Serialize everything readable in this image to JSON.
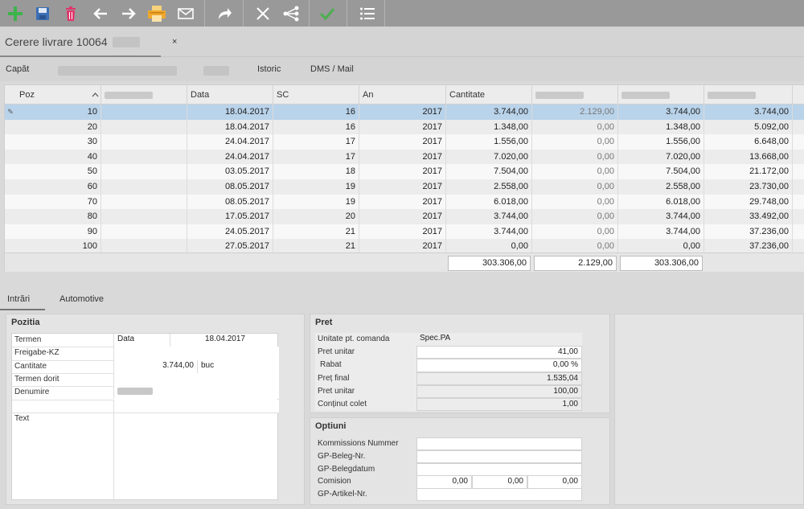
{
  "toolbar": {
    "buttons": [
      {
        "name": "add-icon",
        "color": "#3cb44b"
      },
      {
        "name": "save-icon",
        "color": "#3c6fb4"
      },
      {
        "name": "delete-icon",
        "color": "#e0356b"
      },
      {
        "name": "arrow-left-icon",
        "color": "#ffffff"
      },
      {
        "name": "arrow-right-icon",
        "color": "#ffffff"
      },
      {
        "name": "print-icon",
        "color": "#f0a830"
      },
      {
        "name": "mail-icon",
        "color": "#ffffff"
      },
      {
        "name": "forward-icon",
        "color": "#ffffff"
      },
      {
        "name": "close-x-icon",
        "color": "#ffffff"
      },
      {
        "name": "share-tree-icon",
        "color": "#ffffff"
      },
      {
        "name": "check-icon",
        "color": "#4caf50"
      },
      {
        "name": "list-icon",
        "color": "#ffffff"
      }
    ]
  },
  "document_tab": {
    "title": "Cerere livrare 10064",
    "close": "×"
  },
  "subnav": {
    "header_label": "Capăt",
    "historic": "Istoric",
    "dms": "DMS / Mail"
  },
  "grid": {
    "columns": [
      "Poz",
      "",
      "Data",
      "SC",
      "An",
      "Cantitate",
      "",
      "",
      ""
    ],
    "rows": [
      {
        "poz": "10",
        "data": "18.04.2017",
        "sc": "16",
        "an": "2017",
        "cantitate": "3.744,00",
        "c7": "2.129,00",
        "c8": "3.744,00",
        "c9": "3.744,00"
      },
      {
        "poz": "20",
        "data": "18.04.2017",
        "sc": "16",
        "an": "2017",
        "cantitate": "1.348,00",
        "c7": "0,00",
        "c8": "1.348,00",
        "c9": "5.092,00"
      },
      {
        "poz": "30",
        "data": "24.04.2017",
        "sc": "17",
        "an": "2017",
        "cantitate": "1.556,00",
        "c7": "0,00",
        "c8": "1.556,00",
        "c9": "6.648,00"
      },
      {
        "poz": "40",
        "data": "24.04.2017",
        "sc": "17",
        "an": "2017",
        "cantitate": "7.020,00",
        "c7": "0,00",
        "c8": "7.020,00",
        "c9": "13.668,00"
      },
      {
        "poz": "50",
        "data": "03.05.2017",
        "sc": "18",
        "an": "2017",
        "cantitate": "7.504,00",
        "c7": "0,00",
        "c8": "7.504,00",
        "c9": "21.172,00"
      },
      {
        "poz": "60",
        "data": "08.05.2017",
        "sc": "19",
        "an": "2017",
        "cantitate": "2.558,00",
        "c7": "0,00",
        "c8": "2.558,00",
        "c9": "23.730,00"
      },
      {
        "poz": "70",
        "data": "08.05.2017",
        "sc": "19",
        "an": "2017",
        "cantitate": "6.018,00",
        "c7": "0,00",
        "c8": "6.018,00",
        "c9": "29.748,00"
      },
      {
        "poz": "80",
        "data": "17.05.2017",
        "sc": "20",
        "an": "2017",
        "cantitate": "3.744,00",
        "c7": "0,00",
        "c8": "3.744,00",
        "c9": "33.492,00"
      },
      {
        "poz": "90",
        "data": "24.05.2017",
        "sc": "21",
        "an": "2017",
        "cantitate": "3.744,00",
        "c7": "0,00",
        "c8": "3.744,00",
        "c9": "37.236,00"
      },
      {
        "poz": "100",
        "data": "27.05.2017",
        "sc": "21",
        "an": "2017",
        "cantitate": "0,00",
        "c7": "0,00",
        "c8": "0,00",
        "c9": "37.236,00"
      }
    ],
    "totals": [
      "303.306,00",
      "2.129,00",
      "303.306,00"
    ]
  },
  "lower_tabs": {
    "intrari": "Intrări",
    "automotive": "Automotive"
  },
  "pozitia": {
    "title": "Pozitia",
    "termen_label": "Termen",
    "termen_type": "Data",
    "termen_value": "18.04.2017",
    "freigabe_label": "Freigabe-KZ",
    "cantitate_label": "Cantitate",
    "cantitate_value": "3.744,00",
    "cantitate_unit": "buc",
    "termen_dorit_label": "Termen dorit",
    "denumire_label": "Denumire",
    "text_label": "Text"
  },
  "pret": {
    "title": "Pret",
    "unitate_label": "Unitate pt. comanda",
    "unitate_value": "Spec.PA",
    "pret_unitar_label": "Pret unitar",
    "pret_unitar_value": "41,00",
    "rabat_label": "Rabat",
    "rabat_value": "0,00 %",
    "pret_final_label": "Preț final",
    "pret_final_value": "1.535,04",
    "pret_unitar2_label": "Pret unitar",
    "pret_unitar2_value": "100,00",
    "continut_label": "Conținut colet",
    "continut_value": "1,00"
  },
  "optiuni": {
    "title": "Optiuni",
    "kommissions_label": "Kommissions Nummer",
    "beleg_nr_label": "GP-Beleg-Nr.",
    "belegdatum_label": "GP-Belegdatum",
    "comision_label": "Comision",
    "comision_values": [
      "0,00",
      "0,00",
      "0,00"
    ],
    "artikel_label": "GP-Artikel-Nr."
  }
}
